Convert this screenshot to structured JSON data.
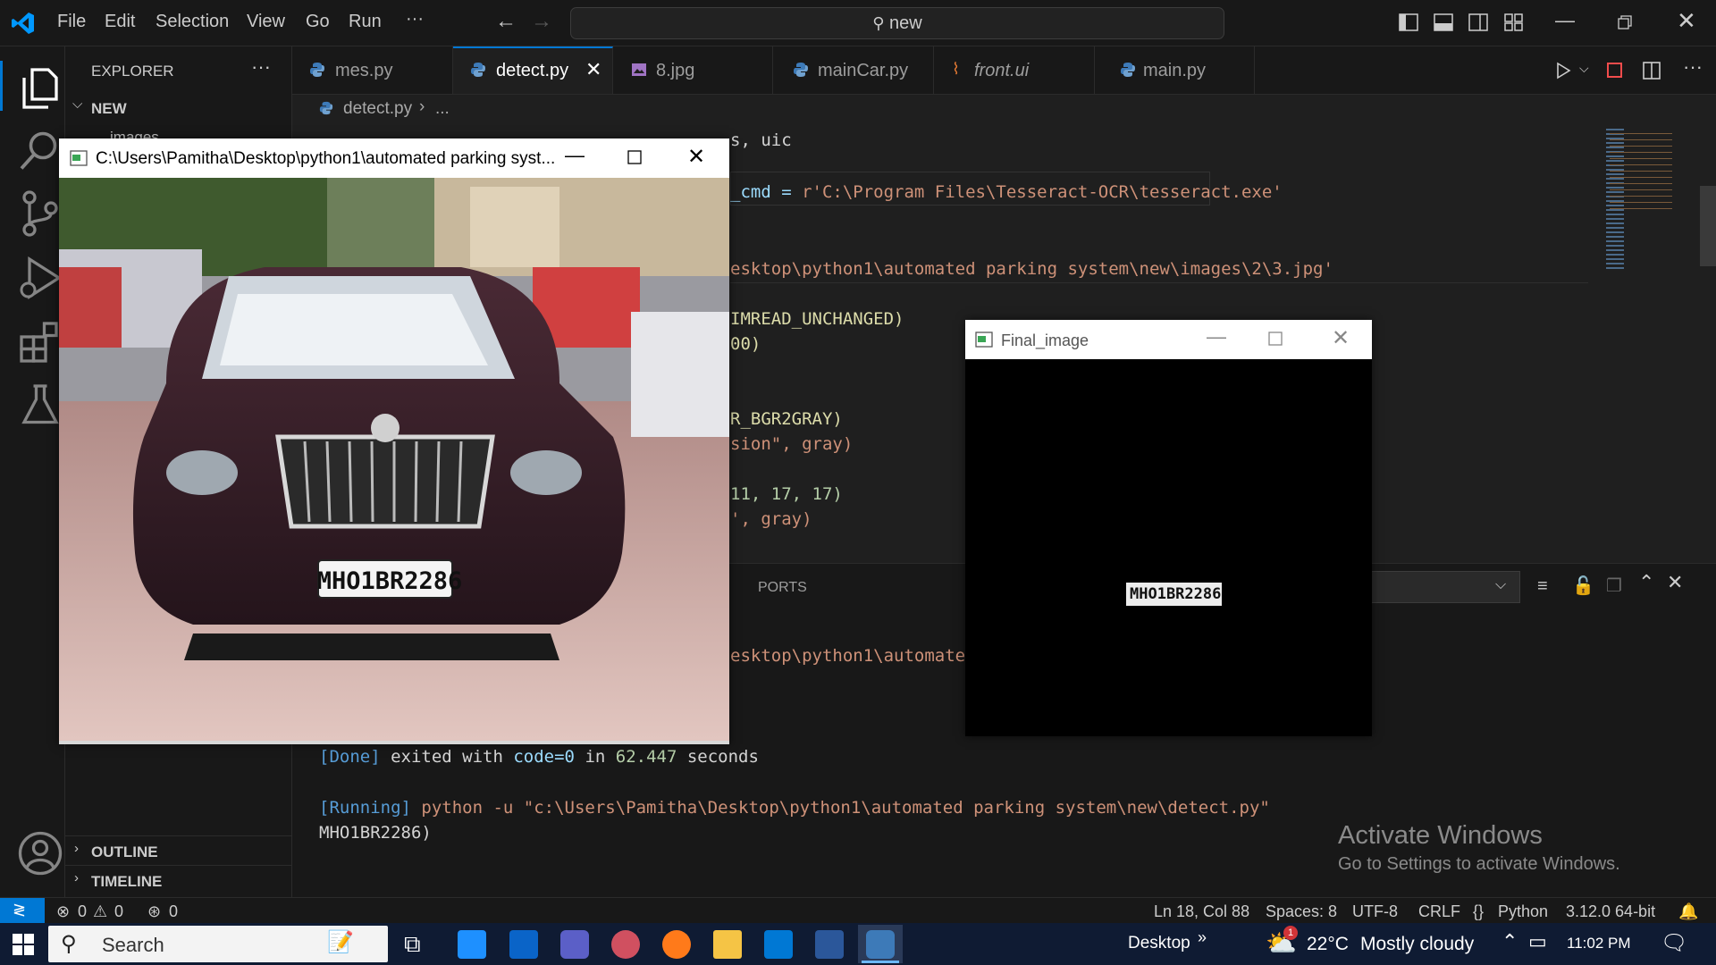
{
  "menu": [
    "File",
    "Edit",
    "Selection",
    "View",
    "Go",
    "Run",
    "···"
  ],
  "command_center": {
    "text": "new"
  },
  "sidebar": {
    "title": "EXPLORER",
    "more": "···",
    "folder": "NEW",
    "truncated_item": "images",
    "outline": "OUTLINE",
    "timeline": "TIMELINE"
  },
  "tabs": [
    {
      "label": "mes.py",
      "type": "py"
    },
    {
      "label": "detect.py",
      "type": "py",
      "active": true
    },
    {
      "label": "8.jpg",
      "type": "img"
    },
    {
      "label": "mainCar.py",
      "type": "py"
    },
    {
      "label": "front.ui",
      "type": "ui"
    },
    {
      "label": "main.py",
      "type": "py"
    }
  ],
  "breadcrumb": {
    "file": "detect.py",
    "more": "..."
  },
  "code_fragments": {
    "l1a": "s, uic",
    "l2a": "_cmd = ",
    "l2b": "r'C:\\Program Files\\Tesseract-OCR\\tesseract.exe'",
    "l3a": "esktop\\python1\\automated parking system\\new\\images\\2\\3.jpg'",
    "l4a": "IMREAD_UNCHANGED)",
    "l5a": "00)",
    "l6a": "R_BGR2GRAY)",
    "l7a": "sion\", gray)",
    "l8a": "11, 17, 17)",
    "l9a": "', gray)"
  },
  "panel": {
    "ports": "PORTS",
    "out1": "esktop\\python1\\automated",
    "done_tag": "[Done]",
    "done_text": " exited with ",
    "done_code": "code=0",
    "done_in": " in ",
    "done_secs": "62.447",
    "done_unit": " seconds",
    "run_tag": "[Running]",
    "run_cmd": " python -u \"c:\\Users\\Pamitha\\Desktop\\python1\\automated parking system\\new\\detect.py\"",
    "result": "MHO1BR2286)"
  },
  "image_window": {
    "title": "C:\\Users\\Pamitha\\Desktop\\python1\\automated parking syst...",
    "plate": "MHO1BR2286"
  },
  "final_window": {
    "title": "Final_image",
    "plate": "MHO1BR2286"
  },
  "watermark": {
    "line1": "Activate Windows",
    "line2": "Go to Settings to activate Windows."
  },
  "status": {
    "errors": "0",
    "warnings": "0",
    "ports": "0",
    "position": "Ln 18, Col 88",
    "spaces": "Spaces: 8",
    "encoding": "UTF-8",
    "eol": "CRLF",
    "language": "Python",
    "interpreter": "3.12.0 64-bit"
  },
  "taskbar": {
    "search": "Search",
    "desktop": "Desktop",
    "chevron": "»",
    "weather_badge": "1",
    "temperature": "22°C",
    "weather": "Mostly cloudy",
    "time": "11:02 PM"
  },
  "colors": {
    "accent": "#0078d4",
    "status_remote": "#0078d4",
    "taskbar": "#0f1b33"
  }
}
